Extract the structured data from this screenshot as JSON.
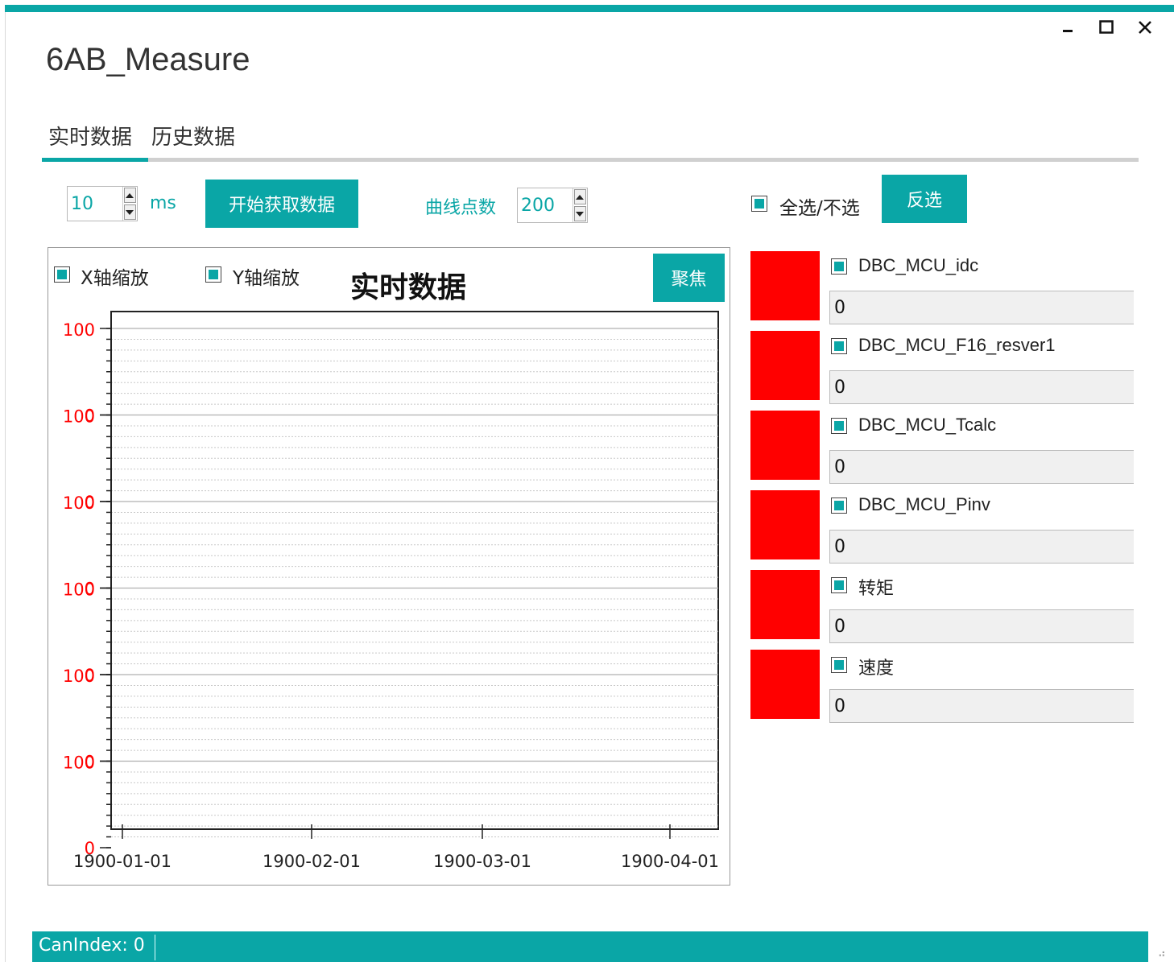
{
  "window": {
    "title": "6AB_Measure",
    "minimize_glyph": "–",
    "maximize_glyph": "□",
    "close_glyph": "✕"
  },
  "tabs": [
    {
      "label": "实时数据",
      "active": true
    },
    {
      "label": "历史数据",
      "active": false
    }
  ],
  "controls": {
    "interval_value": "10",
    "interval_unit": "ms",
    "start_button": "开始获取数据",
    "points_label": "曲线点数",
    "points_value": "200",
    "select_all_label": "全选/不选",
    "invert_button": "反选"
  },
  "chart_panel": {
    "x_zoom_label": "X轴缩放",
    "y_zoom_label": "Y轴缩放",
    "title": "实时数据",
    "focus_button": "聚焦"
  },
  "chart_data": {
    "type": "line",
    "title": "实时数据",
    "x_tick_labels": [
      "1900-01-01",
      "1900-02-01",
      "1900-03-01",
      "1900-04-01"
    ],
    "y_bands": [
      {
        "ylim": [
          0,
          100
        ]
      },
      {
        "ylim": [
          0,
          100
        ]
      },
      {
        "ylim": [
          0,
          100
        ]
      },
      {
        "ylim": [
          0,
          100
        ]
      },
      {
        "ylim": [
          0,
          100
        ]
      },
      {
        "ylim": [
          0,
          100
        ]
      }
    ],
    "y_tick_labels": [
      "100",
      "0"
    ],
    "series": [],
    "grid": true,
    "axis_label_color": "#ff0000"
  },
  "signals": [
    {
      "name": "DBC_MCU_idc",
      "value": "0",
      "color": "#ff0000",
      "checked": true
    },
    {
      "name": "DBC_MCU_F16_resver1",
      "value": "0",
      "color": "#ff0000",
      "checked": true
    },
    {
      "name": "DBC_MCU_Tcalc",
      "value": "0",
      "color": "#ff0000",
      "checked": true
    },
    {
      "name": "DBC_MCU_Pinv",
      "value": "0",
      "color": "#ff0000",
      "checked": true
    },
    {
      "name": "转矩",
      "value": "0",
      "color": "#ff0000",
      "checked": true
    },
    {
      "name": "速度",
      "value": "0",
      "color": "#ff0000",
      "checked": true
    }
  ],
  "status": {
    "text": "CanIndex: 0"
  },
  "colors": {
    "accent": "#0aa6a6",
    "signal": "#ff0000"
  }
}
